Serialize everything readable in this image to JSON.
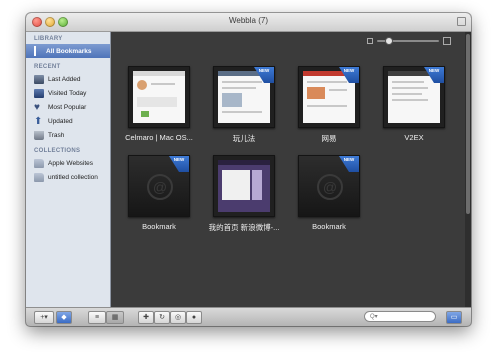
{
  "window": {
    "title": "Webbla (7)"
  },
  "sidebar": {
    "library_heading": "LIBRARY",
    "all_bookmarks": "All Bookmarks",
    "recent_heading": "RECENT",
    "recent": [
      "Last Added",
      "Visited Today",
      "Most Popular",
      "Updated",
      "Trash"
    ],
    "collections_heading": "COLLECTIONS",
    "collections": [
      "Apple Websites",
      "untitled collection"
    ]
  },
  "zoom": {
    "level": 0.15
  },
  "bookmarks": [
    {
      "caption": "Celmaro | Mac OS...",
      "new": false,
      "kind": "screenshot"
    },
    {
      "caption": "玩儿法",
      "new": true,
      "kind": "screenshot"
    },
    {
      "caption": "网易",
      "new": true,
      "kind": "screenshot"
    },
    {
      "caption": "V2EX",
      "new": true,
      "kind": "screenshot"
    },
    {
      "caption": "Bookmark",
      "new": true,
      "kind": "placeholder"
    },
    {
      "caption": "我的首页 新浪微博-...",
      "new": false,
      "kind": "screenshot"
    },
    {
      "caption": "Bookmark",
      "new": true,
      "kind": "placeholder"
    }
  ],
  "badge_label": "NEW",
  "toolbar": {
    "add_label": "+▾",
    "tag_icon": "tag-icon",
    "list_view_icon": "list-view-icon",
    "grid_view_icon": "grid-view-icon",
    "add_item_icon": "plus-icon",
    "refresh_icon": "refresh-icon",
    "preview_icon": "eye-icon",
    "info_icon": "info-icon",
    "search_placeholder": "Q▾",
    "sidebar_toggle_icon": "sidebar-toggle-icon"
  }
}
